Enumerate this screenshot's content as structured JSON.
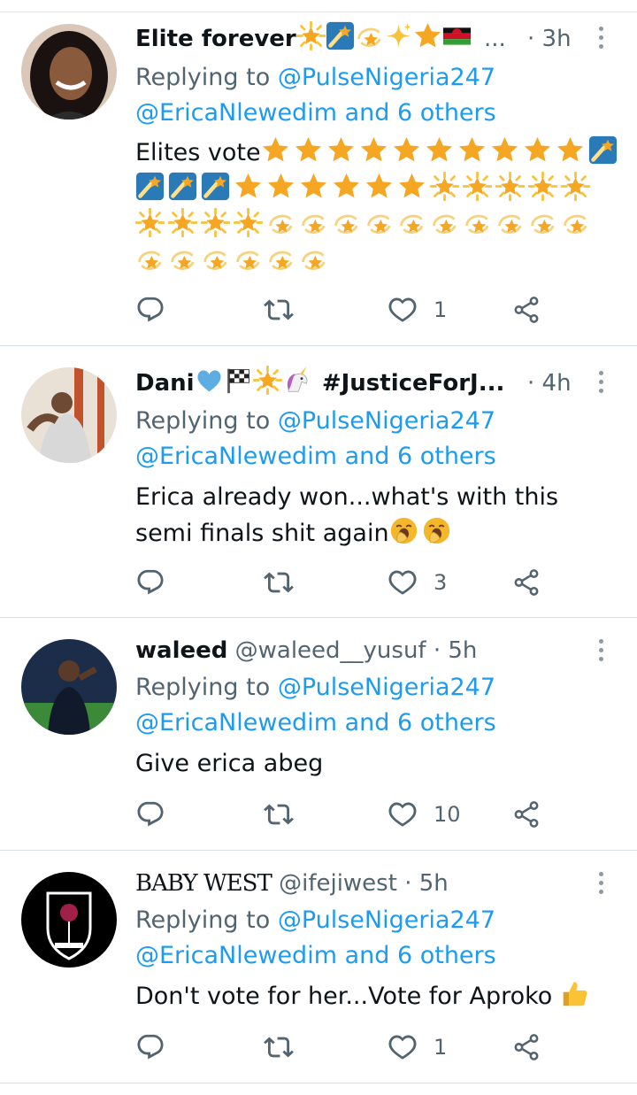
{
  "tweets": [
    {
      "name": "Elite forever",
      "name_emoji": [
        "glowing-star-icon",
        "shooting-star-icon",
        "dizzy-icon",
        "sparkles-icon",
        "star-icon",
        "malawi-flag-icon"
      ],
      "truncation": "...",
      "time": "· 3h",
      "replying_prefix": "Replying to",
      "replying_first": "@PulseNigeria247",
      "replying_rest": "@EricaNlewedim and 6 others",
      "text": "Elites vote",
      "likes": "1"
    },
    {
      "name": "Dani",
      "name_suffix": "#JusticeForJ...",
      "time": "· 4h",
      "replying_prefix": "Replying to",
      "replying_first": "@PulseNigeria247",
      "replying_rest": "@EricaNlewedim and 6 others",
      "text_line1": "Erica already won...what's with this",
      "text_line2": "semi finals shit again",
      "likes": "3"
    },
    {
      "name": "waleed",
      "handle": "@waleed__yusuf",
      "time": "· 5h",
      "replying_prefix": "Replying to",
      "replying_first": "@PulseNigeria247",
      "replying_rest": "@EricaNlewedim and 6 others",
      "text": "Give erica abeg",
      "likes": "10"
    },
    {
      "name": "BABY WEST",
      "handle": "@ifejiwest",
      "time": "· 5h",
      "replying_prefix": "Replying to",
      "replying_first": "@PulseNigeria247",
      "replying_rest": "@EricaNlewedim and 6 others",
      "text": "Don't vote for her...Vote for Aproko",
      "likes": "1"
    }
  ],
  "colors": {
    "link": "#1d9bf0",
    "muted": "#536471",
    "text": "#0f1419",
    "star": "#f5a623"
  }
}
